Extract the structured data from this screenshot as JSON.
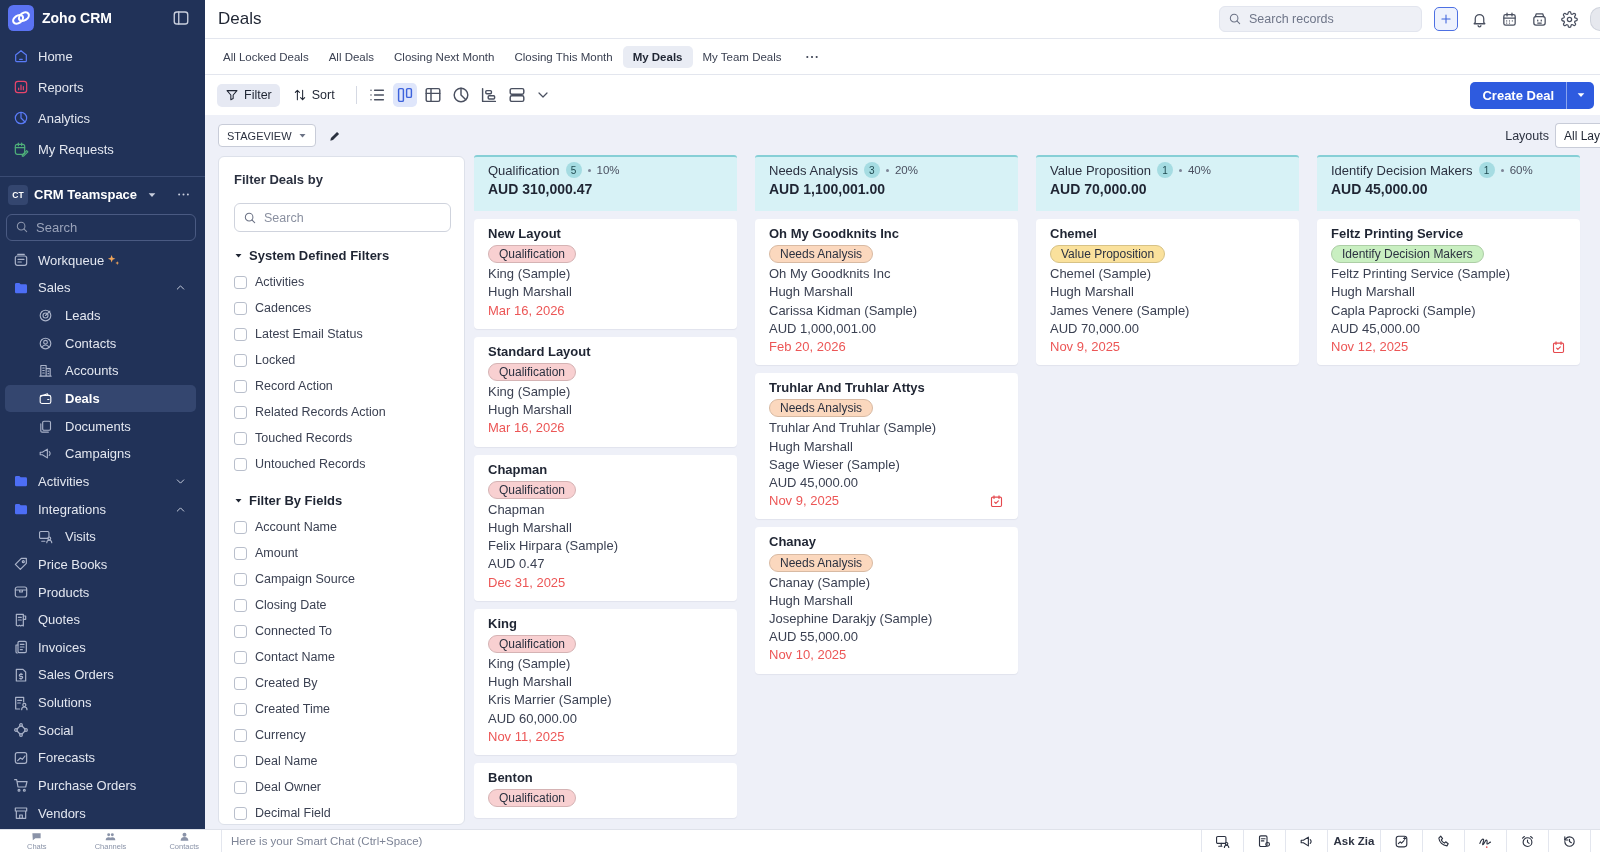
{
  "sidebar": {
    "app_name": "Zoho CRM",
    "top_items": [
      {
        "label": "Home",
        "selected": false
      },
      {
        "label": "Reports",
        "selected": false
      },
      {
        "label": "Analytics",
        "selected": false
      },
      {
        "label": "My Requests",
        "selected": false
      }
    ],
    "teamspace": {
      "badge": "CT",
      "name": "CRM Teamspace"
    },
    "search": {
      "placeholder": "Search"
    },
    "items": [
      {
        "kind": "item",
        "label": "Workqueue",
        "selected": false
      },
      {
        "kind": "group",
        "label": "Sales",
        "selected": false,
        "expanded": true,
        "children": [
          {
            "label": "Leads",
            "selected": false
          },
          {
            "label": "Contacts",
            "selected": false
          },
          {
            "label": "Accounts",
            "selected": false
          },
          {
            "label": "Deals",
            "selected": true
          },
          {
            "label": "Documents",
            "selected": false
          },
          {
            "label": "Campaigns",
            "selected": false
          }
        ]
      },
      {
        "kind": "group",
        "label": "Activities",
        "selected": false,
        "expanded": false
      },
      {
        "kind": "group",
        "label": "Integrations",
        "selected": false,
        "expanded": true,
        "children": [
          {
            "label": "Visits",
            "selected": false
          }
        ]
      },
      {
        "kind": "item",
        "label": "Price Books",
        "selected": false
      },
      {
        "kind": "item",
        "label": "Products",
        "selected": false
      },
      {
        "kind": "item",
        "label": "Quotes",
        "selected": false
      },
      {
        "kind": "item",
        "label": "Invoices",
        "selected": false
      },
      {
        "kind": "item",
        "label": "Sales Orders",
        "selected": false
      },
      {
        "kind": "item",
        "label": "Solutions",
        "selected": false
      },
      {
        "kind": "item",
        "label": "Social",
        "selected": false
      },
      {
        "kind": "item",
        "label": "Forecasts",
        "selected": false
      },
      {
        "kind": "item",
        "label": "Purchase Orders",
        "selected": false
      },
      {
        "kind": "item",
        "label": "Vendors",
        "selected": false
      }
    ]
  },
  "header": {
    "title": "Deals",
    "search": {
      "placeholder": "Search records"
    }
  },
  "tabs": [
    {
      "label": "All Locked Deals",
      "selected": false
    },
    {
      "label": "All Deals",
      "selected": false
    },
    {
      "label": "Closing Next Month",
      "selected": false
    },
    {
      "label": "Closing This Month",
      "selected": false
    },
    {
      "label": "My Deals",
      "selected": true
    },
    {
      "label": "My Team Deals",
      "selected": false
    }
  ],
  "toolbar": {
    "filter": {
      "label": "Filter",
      "active": true
    },
    "sort": {
      "label": "Sort"
    },
    "views": [
      {
        "selected": false
      },
      {
        "selected": true
      },
      {
        "selected": false
      },
      {
        "selected": false
      },
      {
        "selected": false
      },
      {
        "selected": false
      }
    ],
    "create_button": "Create Deal"
  },
  "view_bar": {
    "view_select": "STAGEVIEW",
    "layouts_label": "Layouts",
    "layouts_select": "All Lay"
  },
  "filter_panel": {
    "title": "Filter Deals by",
    "search": {
      "placeholder": "Search"
    },
    "sections": [
      {
        "title": "System Defined Filters",
        "expanded": true,
        "options": [
          {
            "label": "Activities",
            "checked": false
          },
          {
            "label": "Cadences",
            "checked": false
          },
          {
            "label": "Latest Email Status",
            "checked": false
          },
          {
            "label": "Locked",
            "checked": false
          },
          {
            "label": "Record Action",
            "checked": false
          },
          {
            "label": "Related Records Action",
            "checked": false
          },
          {
            "label": "Touched Records",
            "checked": false
          },
          {
            "label": "Untouched Records",
            "checked": false
          }
        ]
      },
      {
        "title": "Filter By Fields",
        "expanded": true,
        "options": [
          {
            "label": "Account Name",
            "checked": false
          },
          {
            "label": "Amount",
            "checked": false
          },
          {
            "label": "Campaign Source",
            "checked": false
          },
          {
            "label": "Closing Date",
            "checked": false
          },
          {
            "label": "Connected To",
            "checked": false
          },
          {
            "label": "Contact Name",
            "checked": false
          },
          {
            "label": "Created By",
            "checked": false
          },
          {
            "label": "Created Time",
            "checked": false
          },
          {
            "label": "Currency",
            "checked": false
          },
          {
            "label": "Deal Name",
            "checked": false
          },
          {
            "label": "Deal Owner",
            "checked": false
          },
          {
            "label": "Decimal Field",
            "checked": false
          }
        ]
      }
    ]
  },
  "stages": [
    {
      "name": "Qualification",
      "count": "5",
      "probability": "10%",
      "total": "AUD 310,000.47",
      "color": "#f8d0d1",
      "cards": [
        {
          "title": "New Layout",
          "tag": "Qualification",
          "lines": [
            "King (Sample)",
            "Hugh Marshall"
          ],
          "date": "Mar 16, 2026",
          "has_task": false
        },
        {
          "title": "Standard Layout",
          "tag": "Qualification",
          "lines": [
            "King (Sample)",
            "Hugh Marshall"
          ],
          "date": "Mar 16, 2026",
          "has_task": false
        },
        {
          "title": "Chapman",
          "tag": "Qualification",
          "lines": [
            "Chapman",
            "Hugh Marshall",
            "Felix Hirpara (Sample)",
            "AUD 0.47"
          ],
          "date": "Dec 31, 2025",
          "has_task": false
        },
        {
          "title": "King",
          "tag": "Qualification",
          "lines": [
            "King (Sample)",
            "Hugh Marshall",
            "Kris Marrier (Sample)",
            "AUD 60,000.00"
          ],
          "date": "Nov 11, 2025",
          "has_task": false
        },
        {
          "title": "Benton",
          "tag": "Qualification"
        }
      ]
    },
    {
      "name": "Needs Analysis",
      "count": "3",
      "probability": "20%",
      "total": "AUD 1,100,001.00",
      "color": "#fbd8be",
      "cards": [
        {
          "title": "Oh My Goodknits Inc",
          "tag": "Needs Analysis",
          "lines": [
            "Oh My Goodknits Inc",
            "Hugh Marshall",
            "Carissa Kidman (Sample)",
            "AUD 1,000,001.00"
          ],
          "date": "Feb 20, 2026",
          "has_task": false
        },
        {
          "title": "Truhlar And Truhlar Attys",
          "tag": "Needs Analysis",
          "lines": [
            "Truhlar And Truhlar (Sample)",
            "Hugh Marshall",
            "Sage Wieser (Sample)",
            "AUD 45,000.00"
          ],
          "date": "Nov 9, 2025",
          "has_task": true
        },
        {
          "title": "Chanay",
          "tag": "Needs Analysis",
          "lines": [
            "Chanay (Sample)",
            "Hugh Marshall",
            "Josephine Darakjy (Sample)",
            "AUD 55,000.00"
          ],
          "date": "Nov 10, 2025",
          "has_task": false
        }
      ]
    },
    {
      "name": "Value Proposition",
      "count": "1",
      "probability": "40%",
      "total": "AUD 70,000.00",
      "color": "#fae19c",
      "cards": [
        {
          "title": "Chemel",
          "tag": "Value Proposition",
          "lines": [
            "Chemel (Sample)",
            "Hugh Marshall",
            "James Venere (Sample)",
            "AUD 70,000.00"
          ],
          "date": "Nov 9, 2025",
          "has_task": false
        }
      ]
    },
    {
      "name": "Identify Decision Makers",
      "count": "1",
      "probability": "60%",
      "total": "AUD 45,000.00",
      "color": "#c9efc1",
      "cards": [
        {
          "title": "Feltz Printing Service",
          "tag": "Identify Decision Makers",
          "lines": [
            "Feltz Printing Service (Sample)",
            "Hugh Marshall",
            "Capla Paprocki (Sample)",
            "AUD 45,000.00"
          ],
          "date": "Nov 12, 2025",
          "has_task": true
        }
      ]
    }
  ],
  "status_bar": {
    "tabs": [
      {
        "label": "Chats"
      },
      {
        "label": "Channels"
      },
      {
        "label": "Contacts"
      }
    ],
    "smart_chat": {
      "placeholder": "Here is your Smart Chat (Ctrl+Space)"
    },
    "zia_label": "Ask Zia"
  }
}
